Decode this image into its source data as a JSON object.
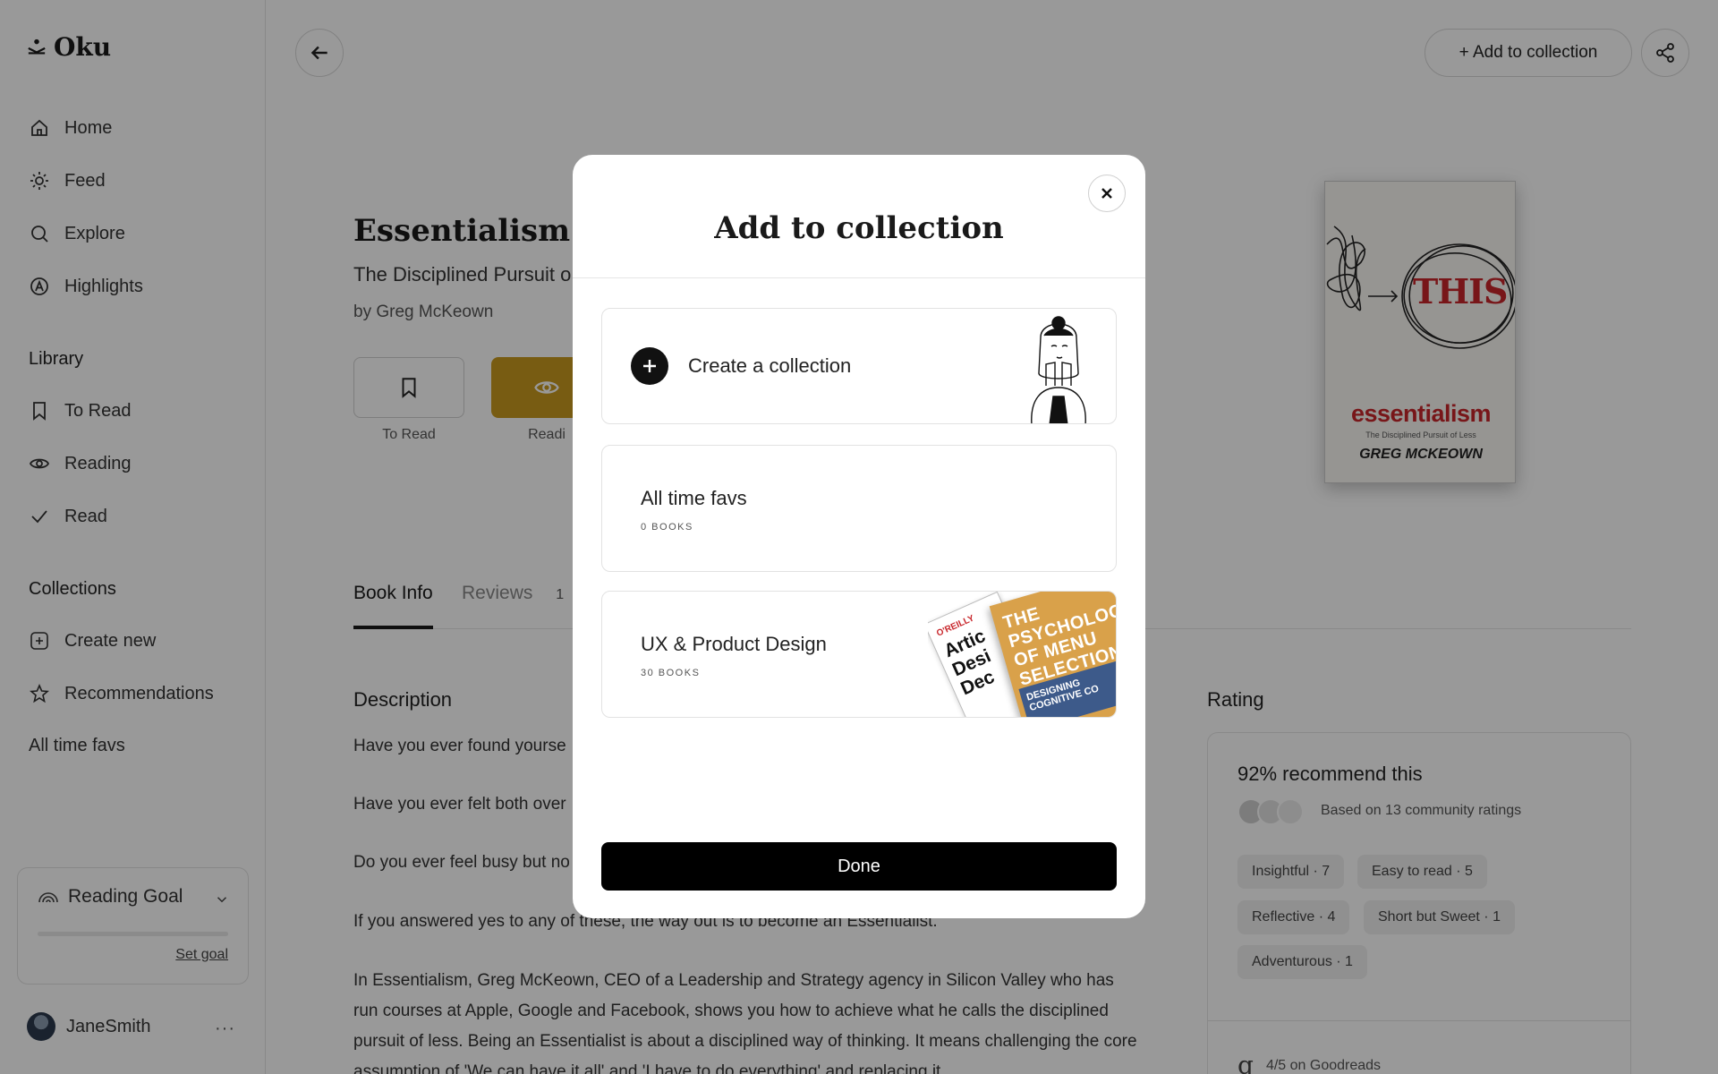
{
  "app": {
    "logo_text": "Oku"
  },
  "sidebar": {
    "nav": [
      {
        "label": "Home",
        "icon": "home-icon"
      },
      {
        "label": "Feed",
        "icon": "sun-icon"
      },
      {
        "label": "Explore",
        "icon": "search-icon"
      },
      {
        "label": "Highlights",
        "icon": "highlights-icon"
      }
    ],
    "library_title": "Library",
    "library": [
      {
        "label": "To Read",
        "icon": "bookmark-icon"
      },
      {
        "label": "Reading",
        "icon": "eye-icon"
      },
      {
        "label": "Read",
        "icon": "check-icon"
      }
    ],
    "collections_title": "Collections",
    "collections": [
      {
        "label": "Create new",
        "icon": "plus-square-icon"
      },
      {
        "label": "Recommendations",
        "icon": "star-icon"
      },
      {
        "label": "All time favs"
      }
    ],
    "goal": {
      "title": "Reading Goal",
      "link": "Set goal",
      "progress": 0
    },
    "user": {
      "name": "JaneSmith",
      "more": "···"
    }
  },
  "header": {
    "add_button": "+ Add to collection"
  },
  "book": {
    "title": "Essentialism",
    "subtitle": "The Disciplined Pursuit o",
    "author": "by Greg McKeown",
    "status_buttons": [
      {
        "label": "To Read"
      },
      {
        "label": "Readi"
      }
    ],
    "cover": {
      "big_word": "THIS",
      "title": "essentialism",
      "subtitle": "The Disciplined Pursuit of Less",
      "author": "GREG MCKEOWN"
    }
  },
  "tabs": {
    "book_info": "Book Info",
    "reviews": "Reviews",
    "reviews_count": "1"
  },
  "description": {
    "title": "Description",
    "paragraphs": [
      "Have you ever found yourse",
      "Have you ever felt both over",
      "Do you ever feel busy but no",
      "If you answered yes to any of these, the way out is to become an Essentialist.",
      "In Essentialism, Greg McKeown, CEO of a Leadership and Strategy agency in Silicon Valley who has run courses at Apple, Google and Facebook, shows you how to achieve what he calls the disciplined pursuit of less. Being an Essentialist is about a disciplined way of thinking. It means challenging the core assumption of 'We can have it all' and 'I have to do everything' and replacing it"
    ]
  },
  "rating": {
    "title": "Rating",
    "headline": "92% recommend this",
    "based_on": "Based on 13 community ratings",
    "tags": [
      "Insightful · 7",
      "Easy to read · 5",
      "Reflective · 4",
      "Short but Sweet · 1",
      "Adventurous · 1"
    ],
    "goodreads": "4/5 on Goodreads",
    "goodreads_logo": "g"
  },
  "modal": {
    "title": "Add to collection",
    "create_label": "Create a collection",
    "collections": [
      {
        "name": "All time favs",
        "count": "0 BOOKS"
      },
      {
        "name": "UX & Product Design",
        "count": "30 BOOKS"
      }
    ],
    "thumb_books": {
      "left_publisher": "O'REILLY",
      "left_title": "Artic Desi Dec",
      "right_title": "THE PSYCHOLOGY OF MENU SELECTION",
      "right_band": "DESIGNING COGNITIVE CO"
    },
    "done": "Done"
  },
  "colors": {
    "accent_gold": "#c99a1e",
    "overlay": "rgba(0,0,0,0.4)",
    "primary_button": "#000000",
    "cover_red": "#c8262b"
  }
}
